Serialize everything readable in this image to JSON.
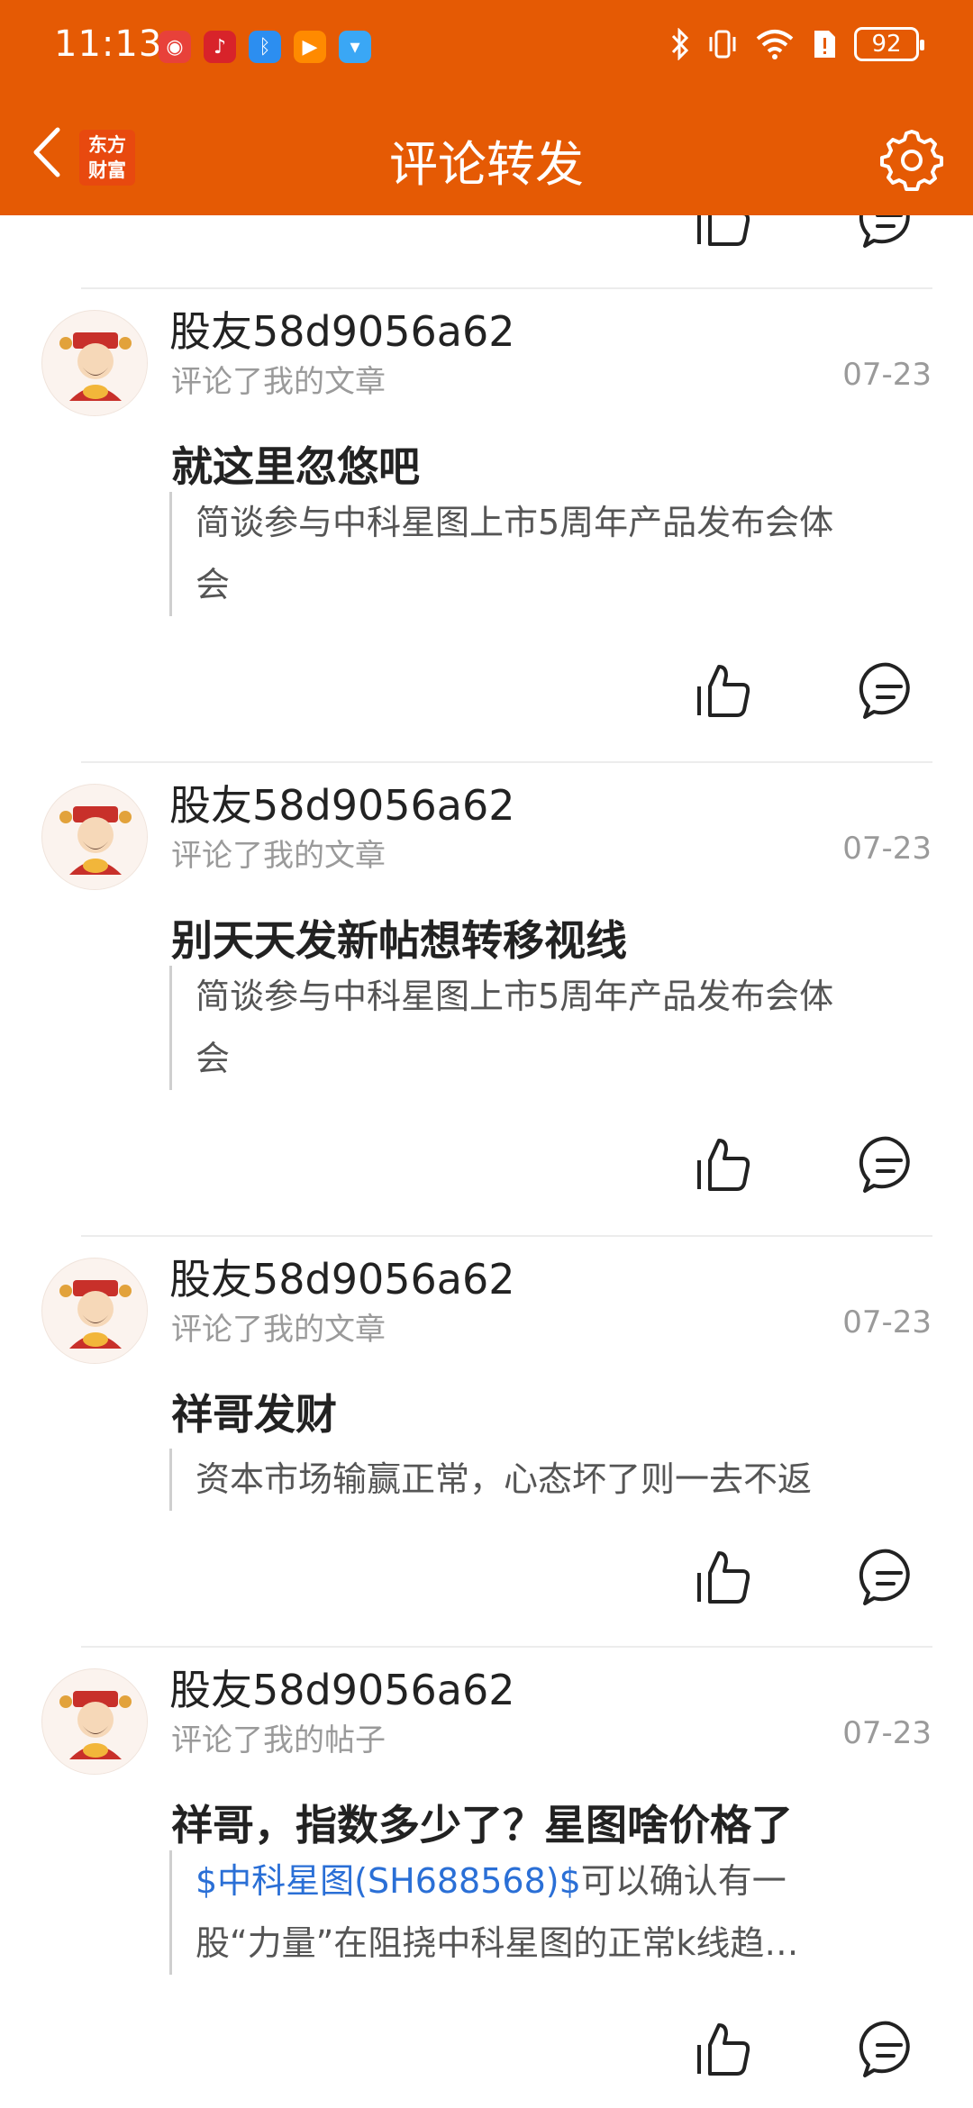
{
  "status_bar": {
    "time": "11:13",
    "battery": "92"
  },
  "nav": {
    "brand_line1": "东方",
    "brand_line2": "财富",
    "title": "评论转发"
  },
  "items": [
    {
      "username": "股友58d9056a62",
      "action": "评论了我的文章",
      "date": "07-23",
      "comment": "就这里忽悠吧",
      "quote_line1": "简谈参与中科星图上市5周年产品发布会体",
      "quote_line2": "会"
    },
    {
      "username": "股友58d9056a62",
      "action": "评论了我的文章",
      "date": "07-23",
      "comment": "别天天发新帖想转移视线",
      "quote_line1": "简谈参与中科星图上市5周年产品发布会体",
      "quote_line2": "会"
    },
    {
      "username": "股友58d9056a62",
      "action": "评论了我的文章",
      "date": "07-23",
      "comment": "祥哥发财",
      "quote_line1": "资本市场输赢正常，心态坏了则一去不返"
    },
    {
      "username": "股友58d9056a62",
      "action": "评论了我的帖子",
      "date": "07-23",
      "comment": "祥哥，指数多少了？星图啥价格了",
      "quote_link": "$中科星图(SH688568)$",
      "quote_line1_rest": "可以确认有一",
      "quote_line2": "股“力量”在阻挠中科星图的正常k线趋…"
    }
  ],
  "colors": {
    "brand_orange": "#e55a04",
    "link_blue": "#2a6fd6"
  },
  "icons": {
    "back": "chevron-left-icon",
    "settings": "gear-icon",
    "like": "thumbs-up-icon",
    "reply": "comment-bubble-icon"
  }
}
